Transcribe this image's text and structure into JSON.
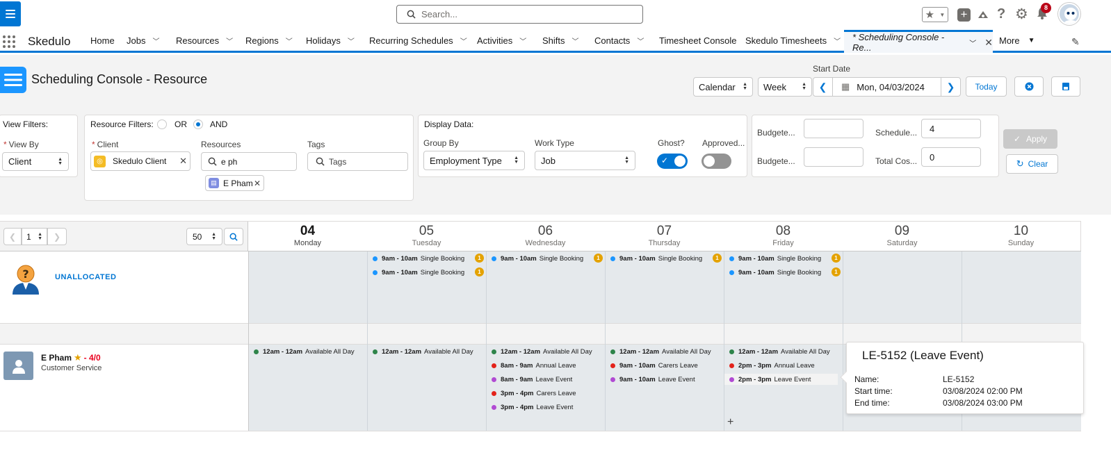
{
  "header": {
    "search_placeholder": "Search...",
    "notification_count": "8"
  },
  "nav": {
    "app_name": "Skedulo",
    "items": [
      {
        "label": "Home",
        "chevron": false
      },
      {
        "label": "Jobs",
        "chevron": true
      },
      {
        "label": "Resources",
        "chevron": true
      },
      {
        "label": "Regions",
        "chevron": true
      },
      {
        "label": "Holidays",
        "chevron": true
      },
      {
        "label": "Recurring Schedules",
        "chevron": true
      },
      {
        "label": "Activities",
        "chevron": true
      },
      {
        "label": "Shifts",
        "chevron": true
      },
      {
        "label": "Contacts",
        "chevron": true
      },
      {
        "label": "Timesheet Console",
        "chevron": false
      },
      {
        "label": "Skedulo Timesheets",
        "chevron": true
      }
    ],
    "active_tab": "* Scheduling Console - Re...",
    "more_label": "More"
  },
  "page": {
    "title": "Scheduling Console - Resource",
    "start_date_label": "Start Date",
    "view_mode": "Calendar",
    "range": "Week",
    "date_value": "Mon, 04/03/2024",
    "today_label": "Today"
  },
  "filters": {
    "view_filters_label": "View Filters:",
    "view_by_label": "View By",
    "view_by_value": "Client",
    "resource_filters_label": "Resource Filters:",
    "or_label": "OR",
    "and_label": "AND",
    "client_label": "Client",
    "client_pill": "Skedulo Client",
    "resources_label": "Resources",
    "resources_value": "e ph",
    "resource_pill": "E Pham",
    "tags_label": "Tags",
    "tags_placeholder": "Tags",
    "display_data_label": "Display Data:",
    "group_by_label": "Group By",
    "group_by_value": "Employment Type",
    "work_type_label": "Work Type",
    "work_type_value": "Job",
    "ghost_label": "Ghost?",
    "approved_label": "Approved...",
    "budget1_label": "Budgete...",
    "budget2_label": "Budgete...",
    "scheduled_label": "Schedule...",
    "scheduled_value": "4",
    "total_cost_label": "Total Cos...",
    "total_cost_value": "0",
    "apply_label": "Apply",
    "clear_label": "Clear"
  },
  "pager": {
    "page": "1",
    "size": "50"
  },
  "days": [
    {
      "num": "04",
      "name": "Monday"
    },
    {
      "num": "05",
      "name": "Tuesday"
    },
    {
      "num": "06",
      "name": "Wednesday"
    },
    {
      "num": "07",
      "name": "Thursday"
    },
    {
      "num": "08",
      "name": "Friday"
    },
    {
      "num": "09",
      "name": "Saturday"
    },
    {
      "num": "10",
      "name": "Sunday"
    }
  ],
  "unallocated": {
    "label": "UNALLOCATED",
    "events": [
      {
        "day": 1,
        "time": "9am - 10am",
        "title": "Single Booking",
        "badge": "1"
      },
      {
        "day": 1,
        "time": "9am - 10am",
        "title": "Single Booking",
        "badge": "1"
      },
      {
        "day": 2,
        "time": "9am - 10am",
        "title": "Single Booking",
        "badge": "1"
      },
      {
        "day": 3,
        "time": "9am - 10am",
        "title": "Single Booking",
        "badge": "1"
      },
      {
        "day": 4,
        "time": "9am - 10am",
        "title": "Single Booking",
        "badge": "1"
      },
      {
        "day": 4,
        "time": "9am - 10am",
        "title": "Single Booking",
        "badge": "1"
      }
    ]
  },
  "resource": {
    "name": "E Pham",
    "score": "- 4/0",
    "role": "Customer Service",
    "events": [
      {
        "day": 0,
        "time": "12am - 12am",
        "title": "Available All Day",
        "color": "#2e844a"
      },
      {
        "day": 1,
        "time": "12am - 12am",
        "title": "Available All Day",
        "color": "#2e844a"
      },
      {
        "day": 2,
        "time": "12am - 12am",
        "title": "Available All Day",
        "color": "#2e844a"
      },
      {
        "day": 2,
        "time": "8am - 9am",
        "title": "Annual Leave",
        "color": "#e3231b"
      },
      {
        "day": 2,
        "time": "8am - 9am",
        "title": "Leave Event",
        "color": "#b14ad3"
      },
      {
        "day": 2,
        "time": "3pm - 4pm",
        "title": "Carers Leave",
        "color": "#e3231b"
      },
      {
        "day": 2,
        "time": "3pm - 4pm",
        "title": "Leave Event",
        "color": "#b14ad3"
      },
      {
        "day": 3,
        "time": "12am - 12am",
        "title": "Available All Day",
        "color": "#2e844a"
      },
      {
        "day": 3,
        "time": "9am - 10am",
        "title": "Carers Leave",
        "color": "#e3231b"
      },
      {
        "day": 3,
        "time": "9am - 10am",
        "title": "Leave Event",
        "color": "#b14ad3"
      },
      {
        "day": 4,
        "time": "12am - 12am",
        "title": "Available All Day",
        "color": "#2e844a"
      },
      {
        "day": 4,
        "time": "2pm - 3pm",
        "title": "Annual Leave",
        "color": "#e3231b"
      },
      {
        "day": 4,
        "time": "2pm - 3pm",
        "title": "Leave Event",
        "color": "#b14ad3"
      }
    ]
  },
  "popover": {
    "title": "LE-5152 (Leave Event)",
    "name_label": "Name:",
    "name_value": "LE-5152",
    "start_label": "Start time:",
    "start_value": "03/08/2024 02:00 PM",
    "end_label": "End time:",
    "end_value": "03/08/2024 03:00 PM"
  },
  "colors": {
    "brand": "#0176d3",
    "unalloc_dot": "#1b96ff"
  }
}
